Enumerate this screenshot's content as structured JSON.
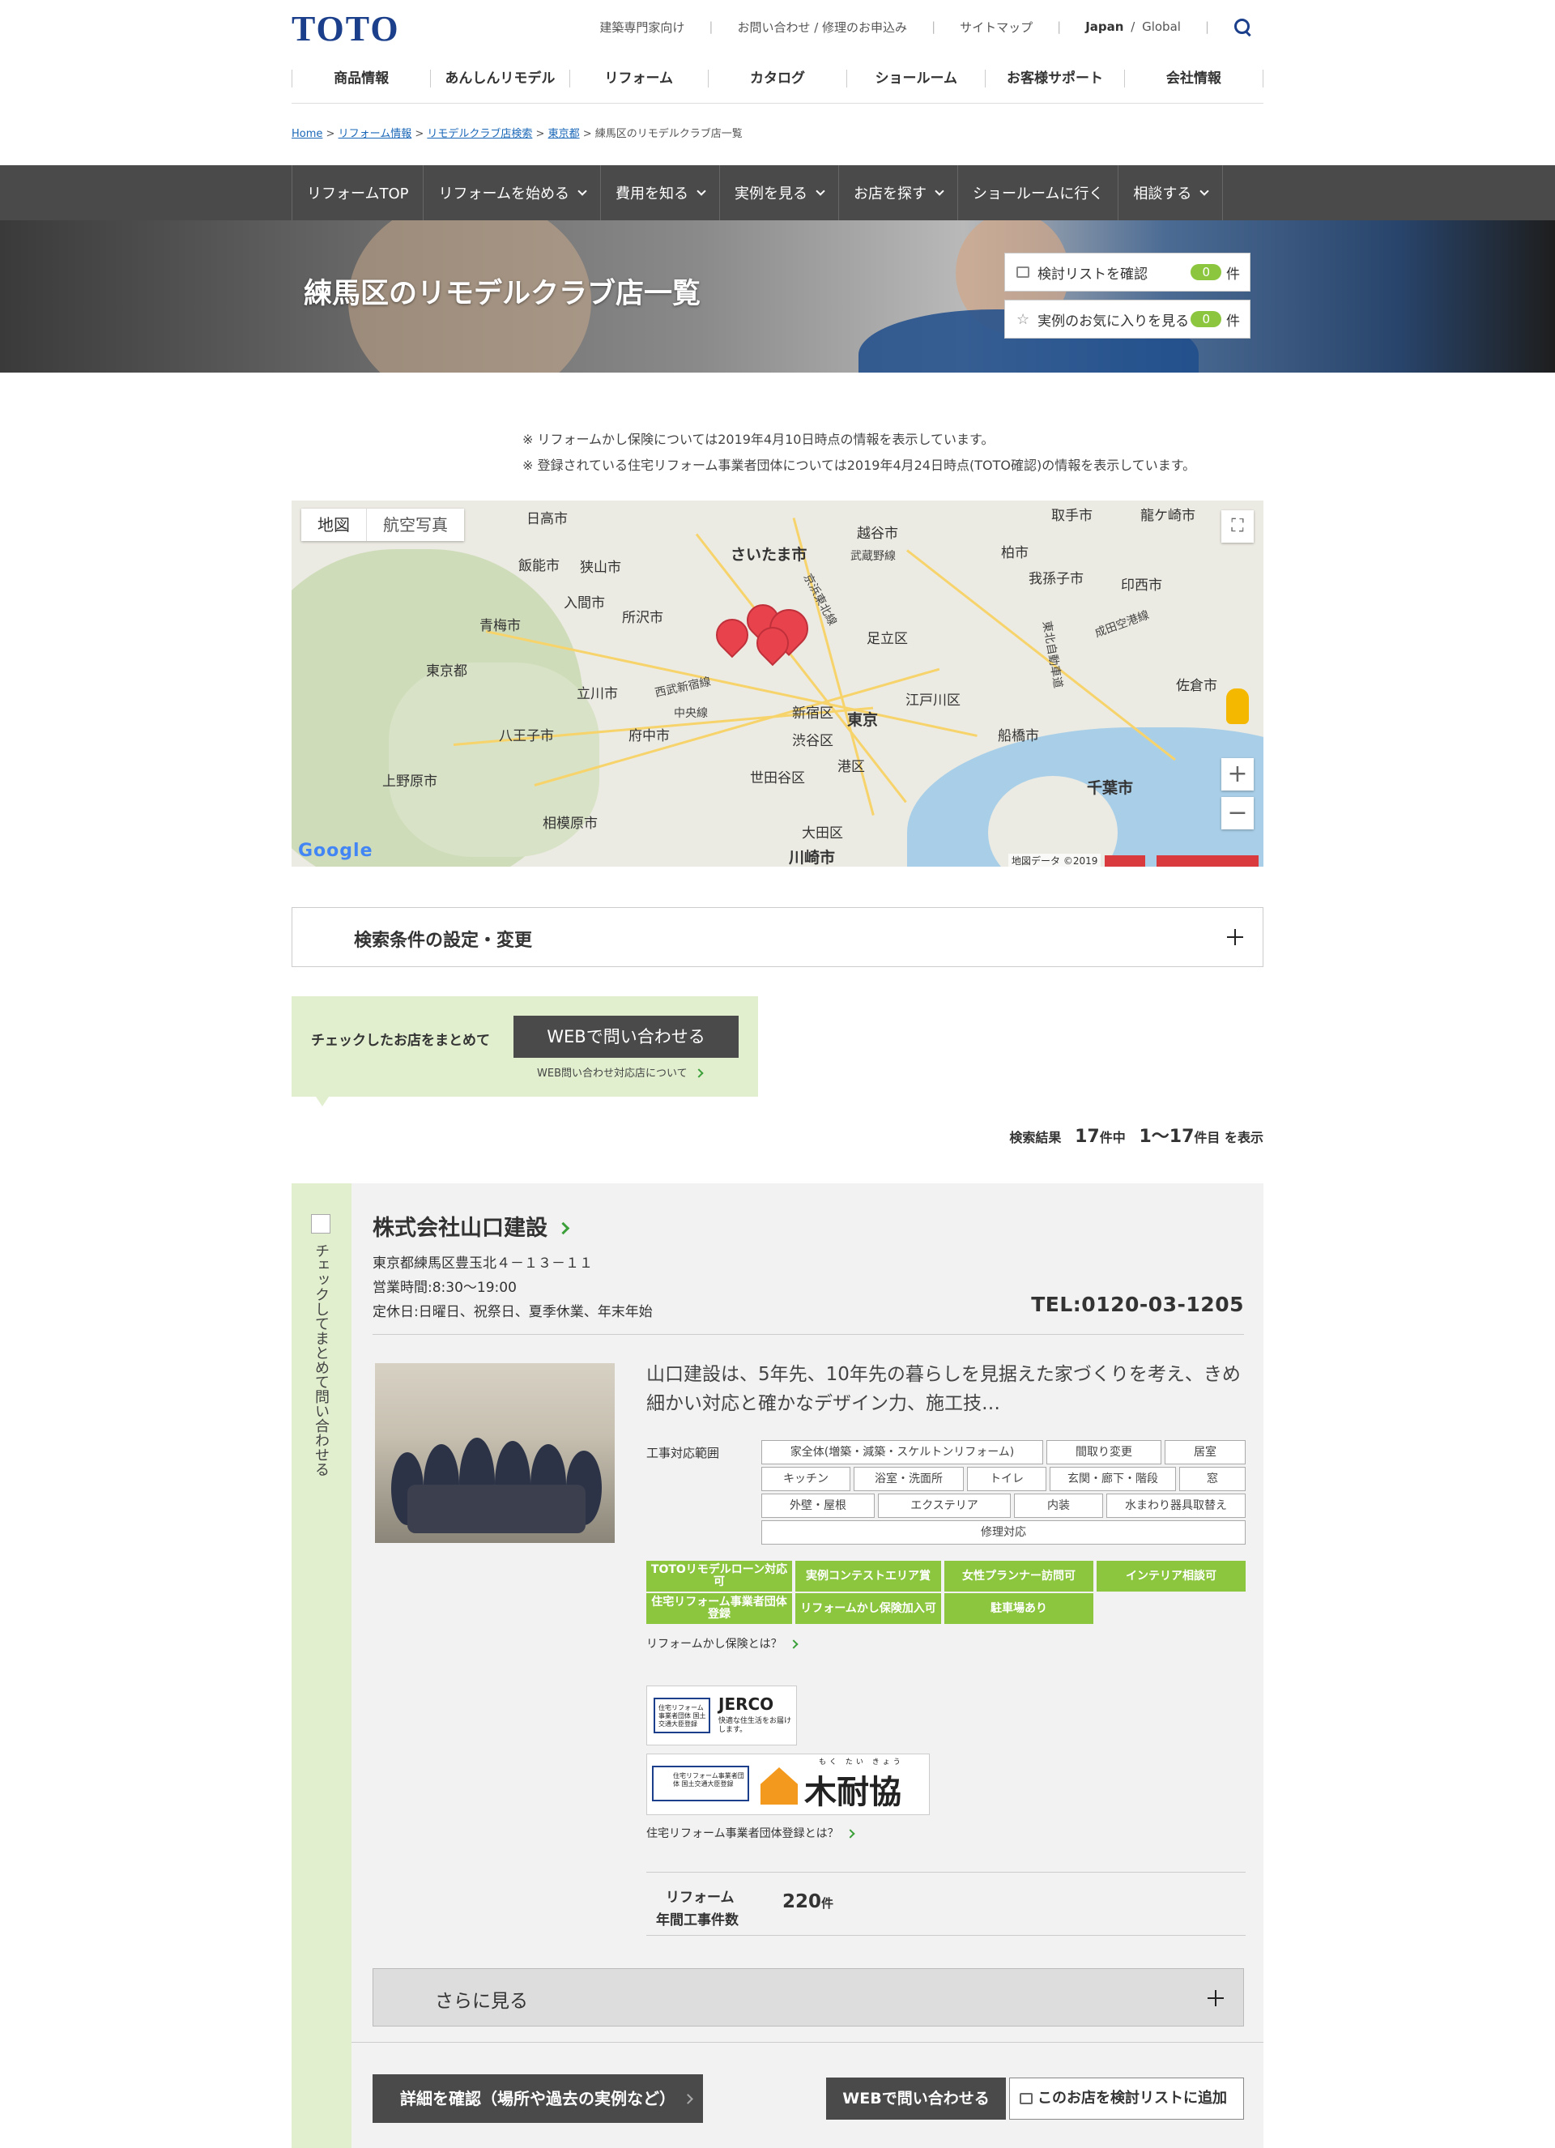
{
  "header": {
    "logo": "TOTO",
    "util_links": [
      "建築専門家向け",
      "お問い合わせ / 修理のお申込み",
      "サイトマップ"
    ],
    "lang_japan": "Japan",
    "lang_sep": "/",
    "lang_global": "Global"
  },
  "gnav": [
    "商品情報",
    "あんしんリモデル",
    "リフォーム",
    "カタログ",
    "ショールーム",
    "お客様サポート",
    "会社情報"
  ],
  "breadcrumb": {
    "items": [
      "Home",
      "リフォーム情報",
      "リモデルクラブ店検索",
      "東京都"
    ],
    "sep": ">",
    "current": "練馬区のリモデルクラブ店一覧"
  },
  "subnav": [
    "リフォームTOP",
    "リフォームを始める",
    "費用を知る",
    "実例を見る",
    "お店を探す",
    "ショールームに行く",
    "相談する"
  ],
  "hero": {
    "title": "練馬区のリモデルクラブ店一覧",
    "list_btn": "検討リストを確認",
    "list_count": "0",
    "fav_btn": "実例のお気に入りを見る",
    "fav_count": "0",
    "unit": "件"
  },
  "notes": [
    "※ リフォームかし保険については2019年4月10日時点の情報を表示しています。",
    "※ 登録されている住宅リフォーム事業者団体については2019年4月24日時点(TOTO確認)の情報を表示しています。"
  ],
  "map": {
    "tab_map": "地図",
    "tab_satellite": "航空写真",
    "labels": [
      "日高市",
      "さいたま市",
      "越谷市",
      "取手市",
      "龍ケ崎市",
      "飯能市",
      "狭山市",
      "武蔵野線",
      "柏市",
      "我孫子市",
      "印西市",
      "入間市",
      "所沢市",
      "青梅市",
      "足立区",
      "成田空港線",
      "東京都",
      "立川市",
      "西武新宿線",
      "江戸川区",
      "佐倉市",
      "中央線",
      "新宿区",
      "東京",
      "八王子市",
      "府中市",
      "渋谷区",
      "船橋市",
      "港区",
      "世田谷区",
      "千葉市",
      "上野原市",
      "相模原市",
      "大田区",
      "川崎市",
      "京浜東北線",
      "東北自動車道"
    ],
    "google": "Google",
    "copyright": "地図データ ©2019"
  },
  "search_cond": {
    "label": "検索条件の設定・変更"
  },
  "check_box": {
    "label": "チェックしたお店をまとめて",
    "button": "WEBで問い合わせる",
    "sub_link": "WEB問い合わせ対応店について"
  },
  "results": {
    "prefix": "検索結果",
    "total": "17",
    "total_unit": "件中",
    "range": "1～17",
    "range_unit": "件目",
    "suffix": "を表示"
  },
  "shop": {
    "side_text": "チェックしてまとめて問い合わせる",
    "name": "株式会社山口建設",
    "address": "東京都練馬区豊玉北４－１３－１１",
    "hours": "営業時間:8:30～19:00",
    "holiday": "定休日:日曜日、祝祭日、夏季休業、年末年始",
    "tel": "TEL:0120-03-1205",
    "description": "山口建設は、5年先、10年先の暮らしを見据えた家づくりを考え、きめ細かい対応と確かなデザイン力、施工技…",
    "koji_label": "工事対応範囲",
    "tags": [
      "家全体(増築・減築・スケルトンリフォーム)",
      "間取り変更",
      "居室",
      "キッチン",
      "浴室・洗面所",
      "トイレ",
      "玄関・廊下・階段",
      "窓",
      "外壁・屋根",
      "エクステリア",
      "内装",
      "水まわり器具取替え",
      "修理対応"
    ],
    "badges": [
      "TOTOリモデルローン対応可",
      "実例コンテストエリア賞",
      "女性プランナー訪問可",
      "インテリア相談可",
      "住宅リフォーム事業者団体登録",
      "リフォームかし保険加入可",
      "駐車場あり"
    ],
    "kashi_link": "リフォームかし保険とは？",
    "jerco": {
      "mark": "住宅リフォーム事業者団体 国土交通大臣登録",
      "name": "JERCO",
      "tagline": "快適な住生活をお届けします。"
    },
    "mokutaikyo": {
      "mark": "住宅リフォーム事業者団体 国土交通大臣登録",
      "ruby": "もく たい きょう",
      "name": "木耐協"
    },
    "dantai_link": "住宅リフォーム事業者団体登録とは？",
    "koji_count_label1": "リフォーム",
    "koji_count_label2": "年間工事件数",
    "koji_count": "220",
    "koji_count_unit": "件",
    "more": "さらに見る",
    "detail_btn": "詳細を確認（場所や過去の実例など）",
    "web_btn": "WEBで問い合わせる",
    "list_btn": "このお店を検討リストに追加"
  }
}
